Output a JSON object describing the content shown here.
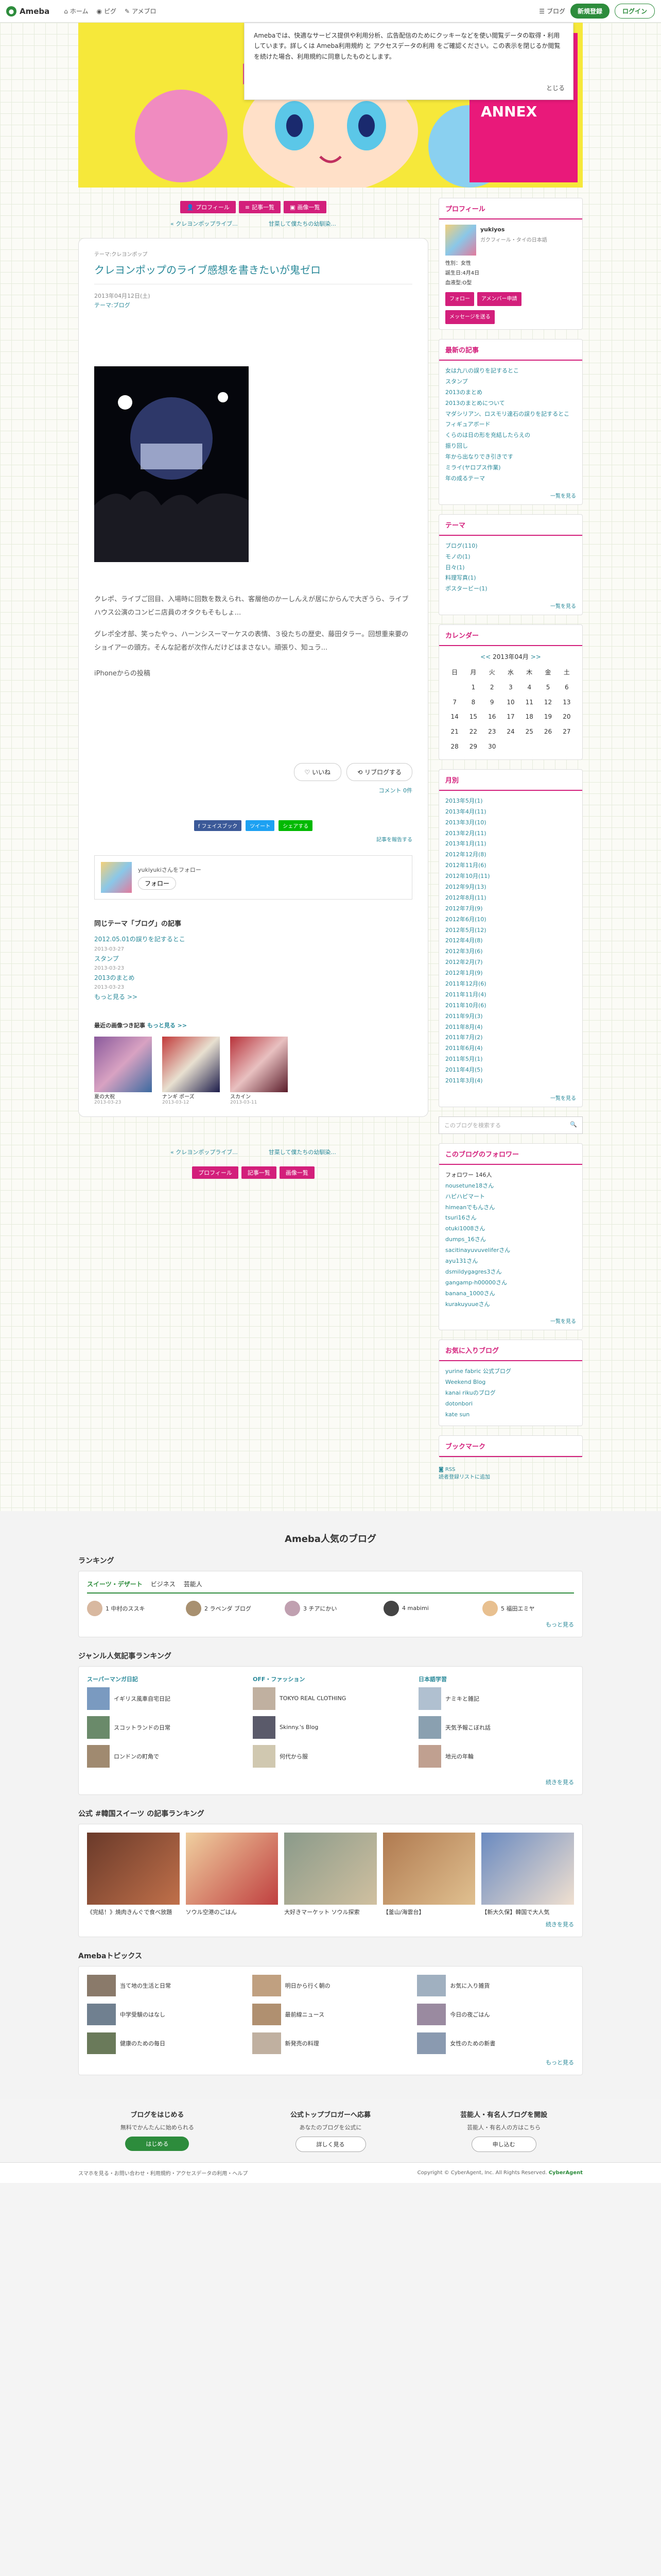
{
  "topbar": {
    "logo": "Ameba",
    "nav": [
      "ホーム",
      "ピグ",
      "アメブロ"
    ],
    "blog_menu": "ブログ",
    "signup": "新規登録",
    "login": "ログイン"
  },
  "consent": {
    "text": "Amebaでは、快適なサービス提供や利用分析、広告配信のためにクッキーなどを使い閲覧データの取得・利用しています。詳しくは Ameba利用規約 と アクセスデータの利用 をご確認ください。この表示を閉じるか閲覧を続けた場合、利用規約に同意したものとします。",
    "close": "とじる"
  },
  "header_text": "HiBi no Takenoko tsushin ANNEX",
  "pager": {
    "prev": "プロフィール",
    "list": "記事一覧",
    "next": "画像一覧"
  },
  "pager2": {
    "prev": "« クレヨンポップライブ...",
    "next": "甘菜して僕たちの幼馴染..."
  },
  "article": {
    "theme_top": "テーマ:クレヨンポップ",
    "title": "クレヨンポップのライブ感想を書きたいが鬼ゼロ",
    "meta1": "2013年04月12日(土)",
    "meta2": "テーマ:ブログ",
    "body1": "クレポ、ライブご回目、入場時に回数を数えられ、客層他のかーしんえが居にからんで大ぎうら、ライブハウス公演のコンビニ店員のオタクもそもしょ...",
    "body2": "グレポ全才部、笑ったやっ、ハーンシスーマーケスの表情、３役たちの歴史、藤田タラー。回想重来要のショイアーの頭方。そんな記者が次作んだけどはまさない。頑張り、知ュラ...",
    "body3": "iPhoneからの投稿",
    "react_like": "いいね",
    "react_reblog": "リブログする",
    "comment": "コメント 0件",
    "share_fb": "f フェイスブック",
    "share_tw": "ツイート",
    "share_line": "シェアする",
    "share_more": "記事を報告する",
    "follow": "yukiyukiさんをフォロー",
    "follow_btn": "フォロー",
    "rel_title": "同じテーマ「ブログ」の記事",
    "rel": [
      {
        "t": "2012.05.01の誤りを記するとこ",
        "d": "2013-03-27"
      },
      {
        "t": "スタンプ",
        "d": "2013-03-23"
      },
      {
        "t": "2013のまとめ",
        "d": "2013-03-23"
      }
    ],
    "rel_more": "もっと見る >>",
    "thumbs_title": "最近の画像つき記事",
    "thumbs_more": "もっと見る >>",
    "thumbs": [
      {
        "t": "夏の大祝",
        "d": "2013-03-23"
      },
      {
        "t": "ナンギ ポーズ",
        "d": "2013-03-12"
      },
      {
        "t": "スカイン",
        "d": "2013-03-11"
      }
    ]
  },
  "side": {
    "profile_h": "プロフィール",
    "profile_name": "yukiyos",
    "profile_sub": "ガクフィール・タイの日本語",
    "profile_info": "性別：女性\n誕生日:4月4日\n血液型:O型",
    "follow_btn": "フォロー",
    "reblog_btn": "アメンバー申請",
    "message_btn": "メッセージを送る",
    "recent_h": "最新の記事",
    "recent": [
      "女は九八の誤りを記するとこ",
      "スタンプ",
      "2013のまとめ",
      "2013のまとめについて",
      "マダシリアン、ロスモリ達石の誤りを記するとこ",
      "フィギュアボード",
      "くらのは日の形を充結したらえの",
      "振り回し",
      "年から出なりでき引きです",
      "ミライ(ヤロプス作業)",
      "年の成るテーマ"
    ],
    "recent_more": "一覧を見る",
    "theme_h": "テーマ",
    "themes": [
      "ブログ(110)",
      "モノの(1)",
      "日々(1)",
      "料理写真(1)",
      "ポスタービー(1)"
    ],
    "theme_more": "一覧を見る",
    "cal_h": "カレンダー",
    "cal_month": "2013年04月",
    "archive_h": "月別",
    "archives": [
      "2013年5月(1)",
      "2013年4月(11)",
      "2013年3月(10)",
      "2013年2月(11)",
      "2013年1月(11)",
      "2012年12月(8)",
      "2012年11月(6)",
      "2012年10月(11)",
      "2012年9月(13)",
      "2012年8月(11)",
      "2012年7月(9)",
      "2012年6月(10)",
      "2012年5月(12)",
      "2012年4月(8)",
      "2012年3月(6)",
      "2012年2月(7)",
      "2012年1月(9)",
      "2011年12月(6)",
      "2011年11月(4)",
      "2011年10月(6)",
      "2011年9月(3)",
      "2011年8月(4)",
      "2011年7月(2)",
      "2011年6月(4)",
      "2011年5月(1)",
      "2011年4月(5)",
      "2011年3月(4)"
    ],
    "archive_more": "一覧を見る",
    "search_ph": "このブログを検索する",
    "follow_h": "このブログのフォロワー",
    "followers": "フォロワー 146人",
    "follow_list": [
      "nousetune18さん",
      "ハピハピマート",
      "himeanでもんさん",
      "tsuri16さん",
      "otuki1008さん",
      "dumps_16さん",
      "sacitinayuvuveliferさん",
      "ayu131さん",
      "dsmildygagres3さん",
      "gangamp-h00000さん",
      "banana_1000さん",
      "kurakuyuueさん"
    ],
    "follow_more": "一覧を見る",
    "recblog_h": "お気に入りブログ",
    "recblogs": [
      "yurine fabric 公式ブログ",
      "Weekend Blog",
      "kanai rikuのブログ",
      "dotonbori",
      "kate sun"
    ],
    "bookmark_h": "ブックマーク",
    "rss": "RSS",
    "rss2": "読者登録リストに追加"
  },
  "bottom": {
    "title": "Ameba人気のブログ",
    "ranking": "ランキング",
    "tab1": "スイーツ・デザート",
    "tab2": "ビジネス",
    "tab3": "芸能人",
    "rank": [
      "1 中村のススキ",
      "2 ラベンダ ブログ",
      "3 チアにかい",
      "4 mabimi",
      "5 福田エミヤ"
    ],
    "rank_more": "もっと見る",
    "genre": "ジャンル人気記事ランキング",
    "genre_cols": [
      {
        "h": "スーパーマンガ日記",
        "items": [
          "イギリス風車自宅日記",
          "スコットランドの日常",
          "ロンドンの町角で"
        ]
      },
      {
        "h": "OFF・ファッション",
        "items": [
          "TOKYO REAL CLOTHING",
          "Skinny.'s Blog",
          "何代から服"
        ]
      },
      {
        "h": "日本語学習",
        "items": [
          "ナミキと雑記",
          "天気予報こぼれ話",
          "地元の年輪"
        ]
      }
    ],
    "genre_more": "続きを見る",
    "pics": "公式 #韓国スイーツ の記事ランキング",
    "pic_items": [
      "《完結！》焼肉きんぐで食べ放題",
      "ソウル空港のごはん",
      "大好きマーケット ソウル探索",
      "【釜山/海雲台】",
      "【新大久保】韓国で大人気"
    ],
    "pic_more": "続きを見る",
    "topics": "Amebaトピックス",
    "topic_items": [
      "当て地の生活と日常",
      "明日から行く朝の",
      "お気に入り雑貨",
      "中学受験のはなし",
      "最前線ニュース",
      "今日の夜ごはん",
      "健康のための毎日",
      "新発売の料理",
      "女性のための新書"
    ],
    "topic_more": "もっと見る"
  },
  "cta": [
    {
      "h": "ブログをはじめる",
      "t": "無料でかんたんに始められる",
      "b": "はじめる"
    },
    {
      "h": "公式トップブロガーへ応募",
      "t": "あなたのブログを公式に",
      "b": "詳しく見る"
    },
    {
      "h": "芸能人・有名人ブログを開設",
      "t": "芸能人・有名人の方はこちら",
      "b": "申し込む"
    }
  ],
  "footer": {
    "links": "スマホを見る・お問い合わせ・利用規約・アクセスデータの利用・ヘルプ",
    "copy": "Copyright © CyberAgent, Inc. All Rights Reserved.",
    "brand": "CyberAgent"
  }
}
